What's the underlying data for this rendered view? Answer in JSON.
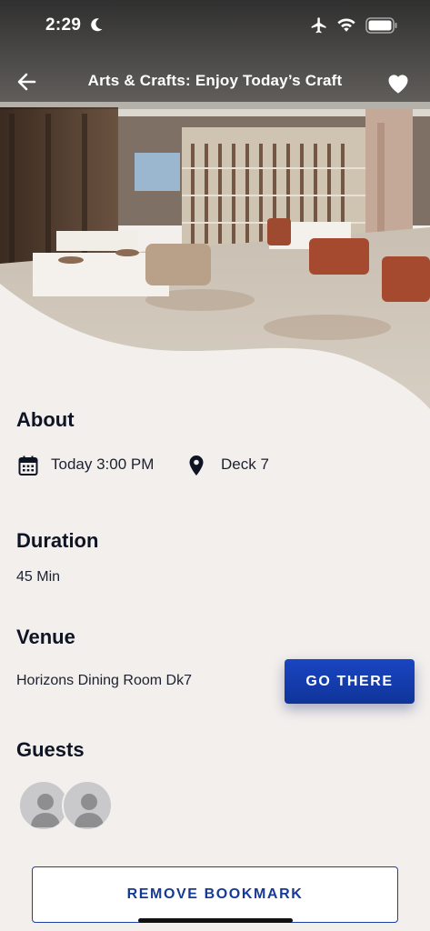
{
  "status_bar": {
    "time": "2:29"
  },
  "nav": {
    "title": "Arts & Crafts: Enjoy Today’s Craft"
  },
  "about": {
    "heading": "About",
    "datetime": "Today 3:00 PM",
    "location": "Deck 7"
  },
  "duration": {
    "heading": "Duration",
    "value": "45 Min"
  },
  "venue": {
    "heading": "Venue",
    "name": "Horizons Dining Room Dk7",
    "go_label": "GO THERE"
  },
  "guests": {
    "heading": "Guests",
    "count_shown": 2
  },
  "footer": {
    "remove_bookmark_label": "REMOVE BOOKMARK"
  },
  "icons": [
    "moon-icon",
    "airplane-icon",
    "wifi-icon",
    "battery-icon",
    "back-arrow-icon",
    "heart-icon",
    "calendar-icon",
    "location-pin-icon",
    "person-icon"
  ],
  "colors": {
    "primary_blue": "#1a45c2",
    "background": "#f3efec",
    "heading_text": "#0e1424"
  }
}
